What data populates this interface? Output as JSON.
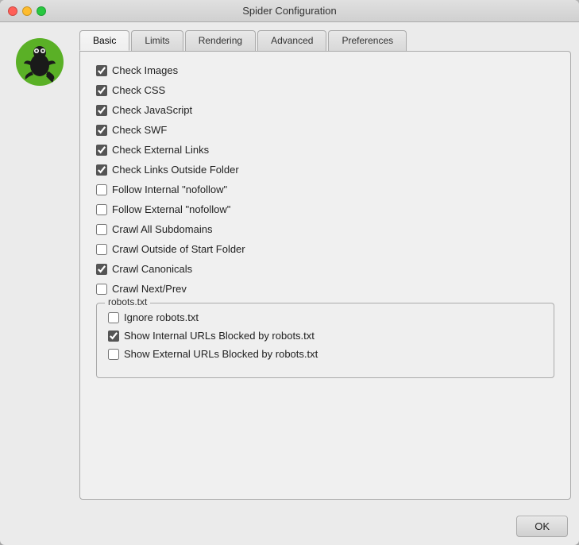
{
  "window": {
    "title": "Spider Configuration"
  },
  "traffic_lights": {
    "close": "close",
    "minimize": "minimize",
    "maximize": "maximize"
  },
  "tabs": [
    {
      "id": "basic",
      "label": "Basic",
      "active": true
    },
    {
      "id": "limits",
      "label": "Limits",
      "active": false
    },
    {
      "id": "rendering",
      "label": "Rendering",
      "active": false
    },
    {
      "id": "advanced",
      "label": "Advanced",
      "active": false
    },
    {
      "id": "preferences",
      "label": "Preferences",
      "active": false
    }
  ],
  "checkboxes": [
    {
      "id": "check-images",
      "label": "Check Images",
      "checked": true
    },
    {
      "id": "check-css",
      "label": "Check CSS",
      "checked": true
    },
    {
      "id": "check-javascript",
      "label": "Check JavaScript",
      "checked": true
    },
    {
      "id": "check-swf",
      "label": "Check SWF",
      "checked": true
    },
    {
      "id": "check-external-links",
      "label": "Check External Links",
      "checked": true
    },
    {
      "id": "check-links-outside-folder",
      "label": "Check Links Outside Folder",
      "checked": true
    },
    {
      "id": "follow-internal-nofollow",
      "label": "Follow Internal \"nofollow\"",
      "checked": false
    },
    {
      "id": "follow-external-nofollow",
      "label": "Follow External \"nofollow\"",
      "checked": false
    },
    {
      "id": "crawl-all-subdomains",
      "label": "Crawl All Subdomains",
      "checked": false
    },
    {
      "id": "crawl-outside-start-folder",
      "label": "Crawl Outside of Start Folder",
      "checked": false
    },
    {
      "id": "crawl-canonicals",
      "label": "Crawl Canonicals",
      "checked": true
    },
    {
      "id": "crawl-next-prev",
      "label": "Crawl Next/Prev",
      "checked": false
    }
  ],
  "robots_group": {
    "legend": "robots.txt",
    "checkboxes": [
      {
        "id": "ignore-robots",
        "label": "Ignore robots.txt",
        "checked": false
      },
      {
        "id": "show-internal-blocked",
        "label": "Show Internal URLs Blocked by robots.txt",
        "checked": true
      },
      {
        "id": "show-external-blocked",
        "label": "Show External URLs Blocked by robots.txt",
        "checked": false
      }
    ]
  },
  "footer": {
    "ok_label": "OK"
  }
}
